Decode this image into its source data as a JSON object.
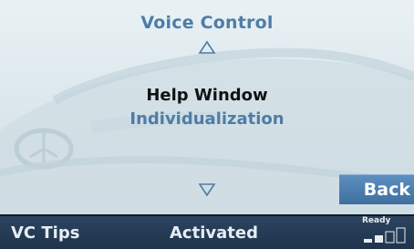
{
  "screen": {
    "title": "Voice Control",
    "menu": [
      {
        "label": "Help Window",
        "selected": true
      },
      {
        "label": "Individualization",
        "selected": false
      }
    ],
    "back_label": "Back"
  },
  "statusbar": {
    "left_label": "VC Tips",
    "center_label": "Activated",
    "ready_label": "Ready",
    "signal_level": 0.5
  },
  "colors": {
    "accent": "#4f7ca6",
    "button": "#4a7aab",
    "statusbar": "#243a54"
  },
  "icons": {
    "scroll_up": "triangle-up-outline",
    "scroll_down": "triangle-down-outline",
    "signal": "signal-strength-bars"
  }
}
